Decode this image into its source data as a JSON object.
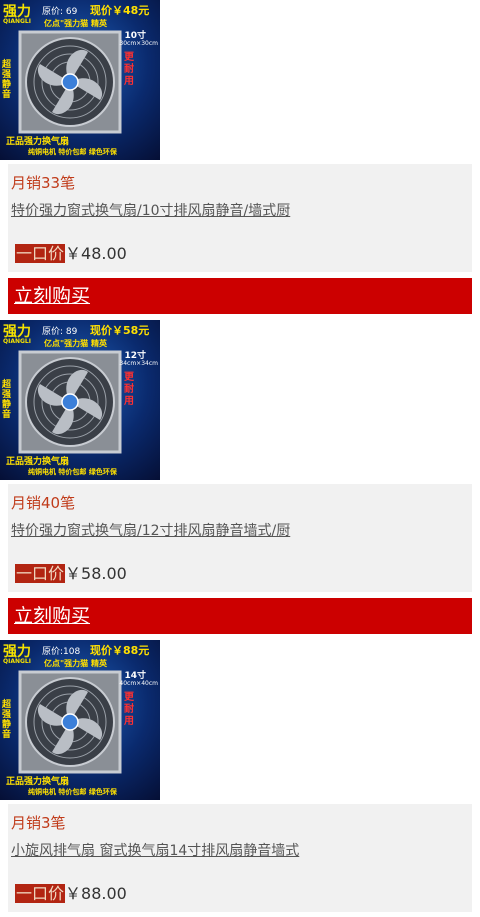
{
  "products": [
    {
      "image": {
        "brand": "强力",
        "brand_sub": "QIANGLI",
        "original_price": "原价: 69",
        "now_price": "现价￥48元",
        "slogan": "亿点\"强力猫 精英",
        "size": "10寸",
        "dims": "30cm×30cm",
        "side_left": "超强静音",
        "side_right": "更耐用",
        "bottom1": "正品强力换气扇",
        "bottom2": "纯铜电机 特价包邮 绿色环保"
      },
      "sales": "月销33笔",
      "title": "特价强力窗式换气扇/10寸排风扇静音/墙式厨",
      "price_label": "一口价",
      "price": "￥48.00",
      "buy_label": "立刻购买"
    },
    {
      "image": {
        "brand": "强力",
        "brand_sub": "QIANGLI",
        "original_price": "原价: 89",
        "now_price": "现价￥58元",
        "slogan": "亿点\"强力猫 精英",
        "size": "12寸",
        "dims": "34cm×34cm",
        "side_left": "超强静音",
        "side_right": "更耐用",
        "bottom1": "正品强力换气扇",
        "bottom2": "纯铜电机 特价包邮 绿色环保"
      },
      "sales": "月销40笔",
      "title": "特价强力窗式换气扇/12寸排风扇静音墙式/厨",
      "price_label": "一口价",
      "price": "￥58.00",
      "buy_label": "立刻购买"
    },
    {
      "image": {
        "brand": "强力",
        "brand_sub": "QIANGLI",
        "original_price": "原价:108",
        "now_price": "现价￥88元",
        "slogan": "亿点\"强力猫 精英",
        "size": "14寸",
        "dims": "40cm×40cm",
        "side_left": "超强静音",
        "side_right": "更耐用",
        "bottom1": "正品强力换气扇",
        "bottom2": "纯铜电机 特价包邮 绿色环保"
      },
      "sales": "月销3笔",
      "title": "小旋风排气扇 窗式换气扇14寸排风扇静音墙式",
      "price_label": "一口价",
      "price": "￥88.00"
    }
  ]
}
